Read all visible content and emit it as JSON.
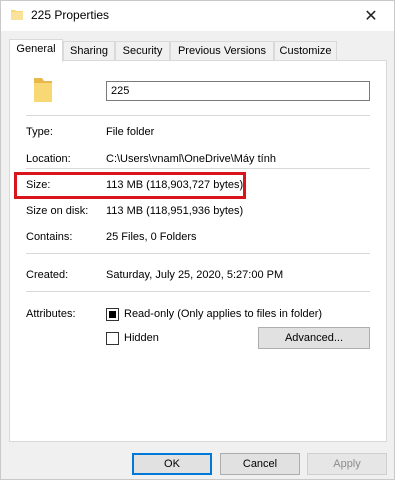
{
  "window": {
    "title": "225 Properties",
    "close_glyph": "✕"
  },
  "tabs": [
    {
      "label": "General",
      "active": true
    },
    {
      "label": "Sharing",
      "active": false
    },
    {
      "label": "Security",
      "active": false
    },
    {
      "label": "Previous Versions",
      "active": false
    },
    {
      "label": "Customize",
      "active": false
    }
  ],
  "general": {
    "name": "225",
    "type_label": "Type:",
    "type_value": "File folder",
    "location_label": "Location:",
    "location_value": "C:\\Users\\vnaml\\OneDrive\\Máy tính",
    "size_label": "Size:",
    "size_value": "113 MB (118,903,727 bytes)",
    "size_on_disk_label": "Size on disk:",
    "size_on_disk_value": "113 MB (118,951,936 bytes)",
    "contains_label": "Contains:",
    "contains_value": "25 Files, 0 Folders",
    "created_label": "Created:",
    "created_value": "Saturday, July 25, 2020, 5:27:00 PM",
    "attributes_label": "Attributes:",
    "readonly_label": "Read-only (Only applies to files in folder)",
    "readonly_state": "indeterminate",
    "hidden_label": "Hidden",
    "hidden_checked": false,
    "advanced_label": "Advanced..."
  },
  "footer": {
    "ok_label": "OK",
    "cancel_label": "Cancel",
    "apply_label": "Apply"
  },
  "colors": {
    "highlight_border": "#d9141b",
    "folder_yellow": "#f8d775",
    "ok_accent": "#0078d7"
  },
  "icons": {
    "title_icon": "folder-icon",
    "large_icon": "folder-icon",
    "close_icon": "close-icon"
  }
}
